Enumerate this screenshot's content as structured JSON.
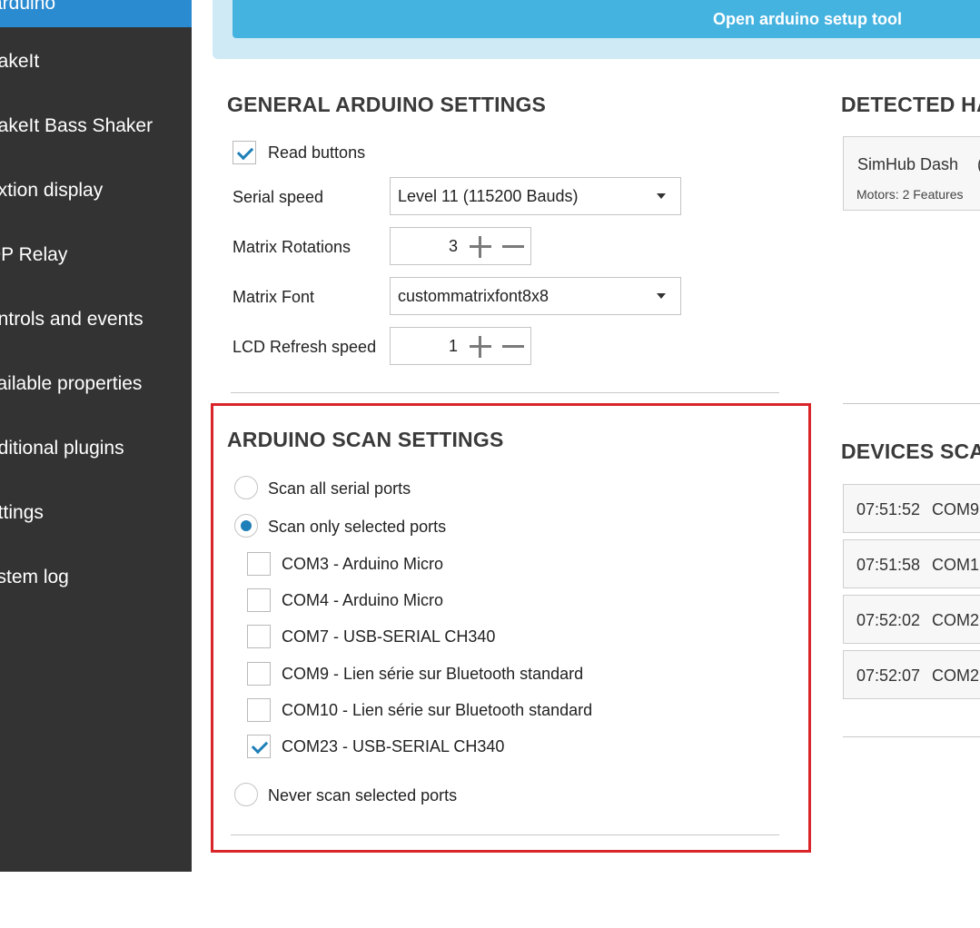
{
  "sidebar": {
    "active": "arduino",
    "items": [
      "hakeIt",
      "hakeIt Bass Shaker",
      "extion display",
      "DP Relay",
      "ontrols and events",
      "vailable properties",
      "dditional plugins",
      "ettings",
      "ystem log"
    ]
  },
  "banner": {
    "setup_button": "Open arduino setup tool"
  },
  "general": {
    "title": "GENERAL ARDUINO SETTINGS",
    "read_buttons": "Read buttons",
    "serial_speed_label": "Serial speed",
    "serial_speed_value": "Level 11 (115200 Bauds)",
    "matrix_rotations_label": "Matrix Rotations",
    "matrix_rotations_value": "3",
    "matrix_font_label": "Matrix Font",
    "matrix_font_value": "custommatrixfont8x8",
    "lcd_refresh_label": "LCD Refresh speed",
    "lcd_refresh_value": "1"
  },
  "scan": {
    "title": "ARDUINO SCAN SETTINGS",
    "scan_all": "Scan all serial ports",
    "scan_selected": "Scan only selected ports",
    "ports": [
      {
        "label": "COM3 - Arduino Micro",
        "checked": false
      },
      {
        "label": "COM4 - Arduino Micro",
        "checked": false
      },
      {
        "label": "COM7 - USB-SERIAL CH340",
        "checked": false
      },
      {
        "label": "COM9 - Lien série sur Bluetooth standard",
        "checked": false
      },
      {
        "label": "COM10 - Lien série sur Bluetooth standard",
        "checked": false
      },
      {
        "label": "COM23 - USB-SERIAL CH340",
        "checked": true
      }
    ],
    "never_scan": "Never scan selected ports"
  },
  "detected": {
    "title": "DETECTED HA",
    "device_name": "SimHub Dash",
    "device_paren": "(",
    "device_meta": "Motors: 2  Features"
  },
  "devices_scan": {
    "title": "DEVICES SCA",
    "entries": [
      {
        "time": "07:51:52",
        "port": "COM9"
      },
      {
        "time": "07:51:58",
        "port": "COM1"
      },
      {
        "time": "07:52:02",
        "port": "COM2"
      },
      {
        "time": "07:52:07",
        "port": "COM2"
      }
    ]
  },
  "colors": {
    "sidebar_bg": "#333333",
    "sidebar_active": "#2b8bd0",
    "button": "#45b3e0",
    "banner": "#cfeaf5",
    "accent": "#1f7fb8",
    "highlight": "#d9252a"
  }
}
